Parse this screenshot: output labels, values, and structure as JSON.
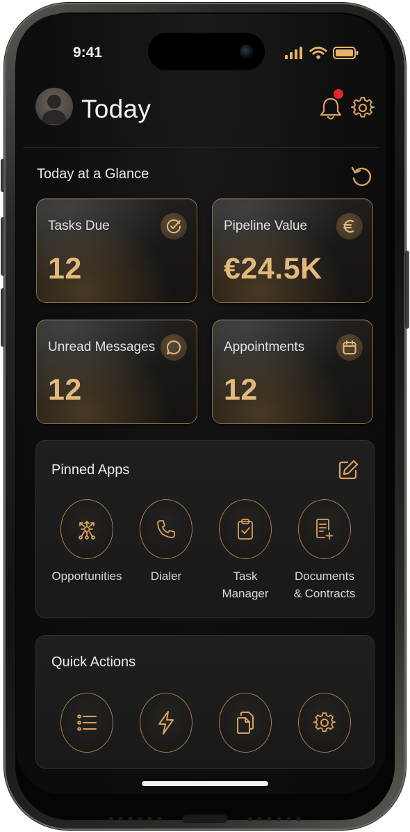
{
  "status_bar": {
    "time": "9:41",
    "icons": [
      "signal-icon",
      "wifi-icon",
      "battery-icon"
    ]
  },
  "header": {
    "title": "Today",
    "has_notification": true,
    "icons": [
      "avatar",
      "bell-icon",
      "gear-icon"
    ]
  },
  "glance": {
    "title": "Today at a Glance",
    "cards": [
      {
        "label": "Tasks Due",
        "value": "12",
        "icon": "check-circle-icon"
      },
      {
        "label": "Pipeline Value",
        "value": "€24.5K",
        "icon": "euro-icon"
      },
      {
        "label": "Unread Messages",
        "value": "12",
        "icon": "chat-bubble-icon"
      },
      {
        "label": "Appointments",
        "value": "12",
        "icon": "calendar-icon"
      }
    ]
  },
  "pinned_apps": {
    "title": "Pinned Apps",
    "apps": [
      {
        "label": "Opportunities",
        "icon": "network-icon"
      },
      {
        "label": "Dialer",
        "icon": "phone-icon"
      },
      {
        "label": "Task\nManager",
        "icon": "clipboard-check-icon"
      },
      {
        "label": "Documents\n& Contracts",
        "icon": "document-add-icon"
      }
    ]
  },
  "quick_actions": {
    "title": "Quick Actions",
    "actions": [
      {
        "icon": "list-icon"
      },
      {
        "icon": "lightning-icon"
      },
      {
        "icon": "copy-documents-icon"
      },
      {
        "icon": "gear-icon"
      }
    ]
  },
  "colors": {
    "accent_gold": "#e2b97d",
    "card_border": "#8a6e44",
    "notification_red": "#e0282a",
    "background": "#0e0e0e"
  }
}
